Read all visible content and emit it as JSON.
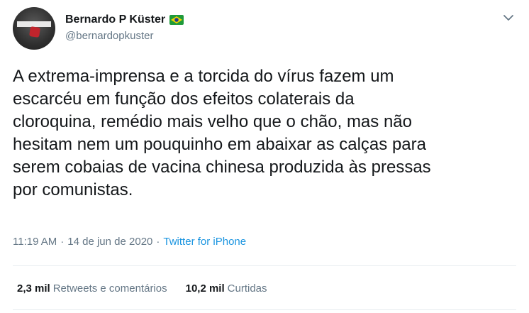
{
  "author": {
    "display_name": "Bernardo P Küster",
    "handle": "@bernardopkuster",
    "flag_icon": "brazil-flag-icon"
  },
  "tweet": {
    "lines": [
      "A extrema-imprensa e a torcida do vírus fazem um",
      "escarcéu em função dos efeitos colaterais da",
      "cloroquina, remédio mais velho que o chão, mas não",
      "hesitam nem um pouquinho em abaixar as calças para",
      "serem cobaias de vacina chinesa produzida às pressas",
      "por comunistas."
    ]
  },
  "meta": {
    "time": "11:19 AM",
    "separator": "·",
    "date": "14 de jun de 2020",
    "source": "Twitter for iPhone"
  },
  "stats": {
    "retweets_count": "2,3 mil",
    "retweets_label": "Retweets e comentários",
    "likes_count": "10,2 mil",
    "likes_label": "Curtidas"
  },
  "colors": {
    "text": "#14171a",
    "secondary": "#657786",
    "link": "#1b95e0",
    "divider": "#e6ecf0"
  }
}
